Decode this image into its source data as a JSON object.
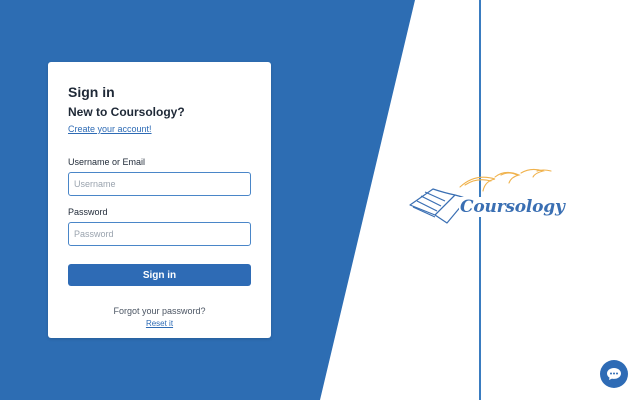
{
  "colors": {
    "brand_blue": "#2e6bb5",
    "panel_blue": "#2d6db3",
    "logo_orange": "#f0b24c"
  },
  "signin_form": {
    "title": "Sign in",
    "subtitle": "New to Coursology?",
    "create_account_link": "Create your account!",
    "username_label": "Username or Email",
    "username_placeholder": "Username",
    "username_value": "",
    "password_label": "Password",
    "password_placeholder": "Password",
    "password_value": "",
    "submit_label": "Sign in",
    "forgot_text": "Forgot your password?",
    "reset_link": "Reset it"
  },
  "logo": {
    "wordmark": "Coursology",
    "icons": [
      "open-book-icon",
      "flying-birds-icon"
    ]
  },
  "chat_widget": {
    "icon": "chat-bubble-icon"
  }
}
